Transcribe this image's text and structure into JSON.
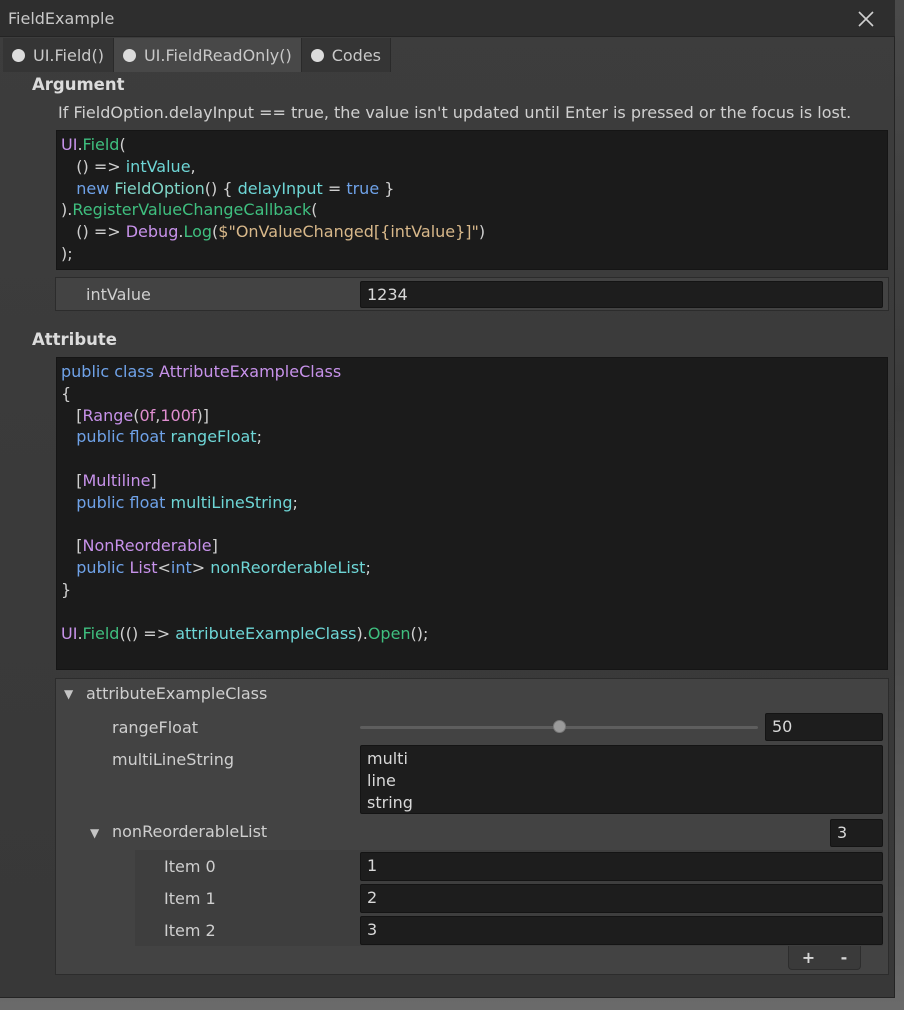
{
  "window": {
    "title": "FieldExample"
  },
  "tabs": [
    {
      "label": "UI.Field()"
    },
    {
      "label": "UI.FieldReadOnly()"
    },
    {
      "label": "Codes"
    }
  ],
  "argument": {
    "title": "Argument",
    "description": "If FieldOption.delayInput == true, the value isn't updated until Enter is pressed or the focus is lost.",
    "field_label": "intValue",
    "field_value": "1234"
  },
  "attribute": {
    "title": "Attribute",
    "foldout_label": "attributeExampleClass",
    "range_label": "rangeFloat",
    "range_value": "50",
    "range_fraction": 0.5,
    "multiline_label": "multiLineString",
    "multiline_lines": [
      "multi",
      "line",
      "string"
    ],
    "list_label": "nonReorderableList",
    "list_size": "3",
    "items": [
      {
        "label": "Item 0",
        "value": "1"
      },
      {
        "label": "Item 1",
        "value": "2"
      },
      {
        "label": "Item 2",
        "value": "3"
      }
    ],
    "add_label": "+",
    "remove_label": "-"
  },
  "colors": {
    "keyword": "#6fa2e8",
    "type": "#7fd6c8",
    "class": "#c792ea",
    "method": "#3fbf7f",
    "variable": "#6ed6d6",
    "string": "#d8b88a",
    "number": "#e08ed0"
  },
  "code1": [
    [
      [
        "cl",
        "UI"
      ],
      [
        "pl",
        "."
      ],
      [
        "fn",
        "Field"
      ],
      [
        "pl",
        "("
      ]
    ],
    [
      [
        "pl",
        "   () => "
      ],
      [
        "va",
        "intValue"
      ],
      [
        "pl",
        ","
      ]
    ],
    [
      [
        "pl",
        "   "
      ],
      [
        "kw",
        "new "
      ],
      [
        "ty",
        "FieldOption"
      ],
      [
        "pl",
        "() { "
      ],
      [
        "va",
        "delayInput"
      ],
      [
        "pl",
        " = "
      ],
      [
        "kw",
        "true"
      ],
      [
        "pl",
        " }"
      ]
    ],
    [
      [
        "pl",
        ")."
      ],
      [
        "fn",
        "RegisterValueChangeCallback"
      ],
      [
        "pl",
        "("
      ]
    ],
    [
      [
        "pl",
        "   () => "
      ],
      [
        "cl",
        "Debug"
      ],
      [
        "pl",
        "."
      ],
      [
        "fn",
        "Log"
      ],
      [
        "pl",
        "("
      ],
      [
        "st",
        "$\"OnValueChanged[{intValue}]\""
      ],
      [
        "pl",
        ")"
      ]
    ],
    [
      [
        "pl",
        ");"
      ]
    ]
  ],
  "code2": [
    [
      [
        "kw",
        "public class "
      ],
      [
        "cl",
        "AttributeExampleClass"
      ]
    ],
    [
      [
        "pl",
        "{"
      ]
    ],
    [
      [
        "pl",
        "   ["
      ],
      [
        "cl",
        "Range"
      ],
      [
        "pl",
        "("
      ],
      [
        "nm",
        "0f"
      ],
      [
        "pl",
        ","
      ],
      [
        "nm",
        "100f"
      ],
      [
        "pl",
        ")]"
      ]
    ],
    [
      [
        "pl",
        "   "
      ],
      [
        "kw",
        "public float "
      ],
      [
        "va",
        "rangeFloat"
      ],
      [
        "pl",
        ";"
      ]
    ],
    [
      [
        "pl",
        ""
      ]
    ],
    [
      [
        "pl",
        "   ["
      ],
      [
        "cl",
        "Multiline"
      ],
      [
        "pl",
        "]"
      ]
    ],
    [
      [
        "pl",
        "   "
      ],
      [
        "kw",
        "public float "
      ],
      [
        "va",
        "multiLineString"
      ],
      [
        "pl",
        ";"
      ]
    ],
    [
      [
        "pl",
        ""
      ]
    ],
    [
      [
        "pl",
        "   ["
      ],
      [
        "cl",
        "NonReorderable"
      ],
      [
        "pl",
        "]"
      ]
    ],
    [
      [
        "pl",
        "   "
      ],
      [
        "kw",
        "public "
      ],
      [
        "cl",
        "List"
      ],
      [
        "pl",
        "<"
      ],
      [
        "kw",
        "int"
      ],
      [
        "pl",
        "> "
      ],
      [
        "va",
        "nonReorderableList"
      ],
      [
        "pl",
        ";"
      ]
    ],
    [
      [
        "pl",
        "}"
      ]
    ],
    [
      [
        "pl",
        ""
      ]
    ],
    [
      [
        "cl",
        "UI"
      ],
      [
        "pl",
        "."
      ],
      [
        "fn",
        "Field"
      ],
      [
        "pl",
        "(() => "
      ],
      [
        "va",
        "attributeExampleClass"
      ],
      [
        "pl",
        ")."
      ],
      [
        "fn",
        "Open"
      ],
      [
        "pl",
        "();"
      ]
    ]
  ]
}
